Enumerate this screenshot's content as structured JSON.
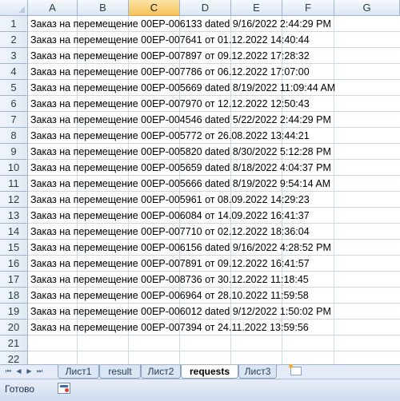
{
  "columns": [
    "A",
    "B",
    "C",
    "D",
    "E",
    "F",
    "G"
  ],
  "selected_column": "C",
  "rows": [
    {
      "n": "1",
      "text": "Заказ на перемещение 00ЕР-006133 dated 9/16/2022 2:44:29 PM"
    },
    {
      "n": "2",
      "text": "Заказ на перемещение 00ЕР-007641 от 01.12.2022 14:40:44"
    },
    {
      "n": "3",
      "text": "Заказ на перемещение 00ЕР-007897 от 09.12.2022 17:28:32"
    },
    {
      "n": "4",
      "text": "Заказ на перемещение 00ЕР-007786 от 06.12.2022 17:07:00"
    },
    {
      "n": "5",
      "text": "Заказ на перемещение 00ЕР-005669 dated 8/19/2022 11:09:44 AM"
    },
    {
      "n": "6",
      "text": "Заказ на перемещение 00ЕР-007970 от 12.12.2022 12:50:43"
    },
    {
      "n": "7",
      "text": "Заказ на перемещение 00ЕР-004546 dated 5/22/2022 2:44:29 PM"
    },
    {
      "n": "8",
      "text": "Заказ на перемещение 00ЕР-005772 от 26.08.2022 13:44:21"
    },
    {
      "n": "9",
      "text": "Заказ на перемещение 00ЕР-005820 dated 8/30/2022 5:12:28 PM"
    },
    {
      "n": "10",
      "text": "Заказ на перемещение 00ЕР-005659 dated 8/18/2022 4:04:37 PM"
    },
    {
      "n": "11",
      "text": "Заказ на перемещение 00ЕР-005666 dated 8/19/2022 9:54:14 AM"
    },
    {
      "n": "12",
      "text": "Заказ на перемещение 00ЕР-005961 от 08.09.2022 14:29:23"
    },
    {
      "n": "13",
      "text": "Заказ на перемещение 00ЕР-006084 от 14.09.2022 16:41:37"
    },
    {
      "n": "14",
      "text": "Заказ на перемещение 00ЕР-007710 от 02.12.2022 18:36:04"
    },
    {
      "n": "15",
      "text": "Заказ на перемещение 00ЕР-006156 dated 9/16/2022 4:28:52 PM"
    },
    {
      "n": "16",
      "text": "Заказ на перемещение 00ЕР-007891 от 09.12.2022 16:41:57"
    },
    {
      "n": "17",
      "text": "Заказ на перемещение 00ЕР-008736 от 30.12.2022 11:18:45"
    },
    {
      "n": "18",
      "text": "Заказ на перемещение 00ЕР-006964 от 28.10.2022 11:59:58"
    },
    {
      "n": "19",
      "text": "Заказ на перемещение 00ЕР-006012 dated 9/12/2022 1:50:02 PM"
    },
    {
      "n": "20",
      "text": "Заказ на перемещение 00ЕР-007394 от 24.11.2022 13:59:56"
    },
    {
      "n": "21",
      "text": ""
    },
    {
      "n": "22",
      "text": ""
    }
  ],
  "sheet_tabs": [
    {
      "label": "Лист1",
      "active": false
    },
    {
      "label": "result",
      "active": false
    },
    {
      "label": "Лист2",
      "active": false
    },
    {
      "label": "requests",
      "active": true
    },
    {
      "label": "Лист3",
      "active": false
    }
  ],
  "nav_buttons": [
    "first-sheet-icon",
    "prev-sheet-icon",
    "next-sheet-icon",
    "last-sheet-icon"
  ],
  "status": {
    "ready_label": "Готово"
  },
  "colors": {
    "grid_line": "#d0d7e5",
    "header_border": "#9eb6ce",
    "selected_header": "#f5c25b"
  }
}
